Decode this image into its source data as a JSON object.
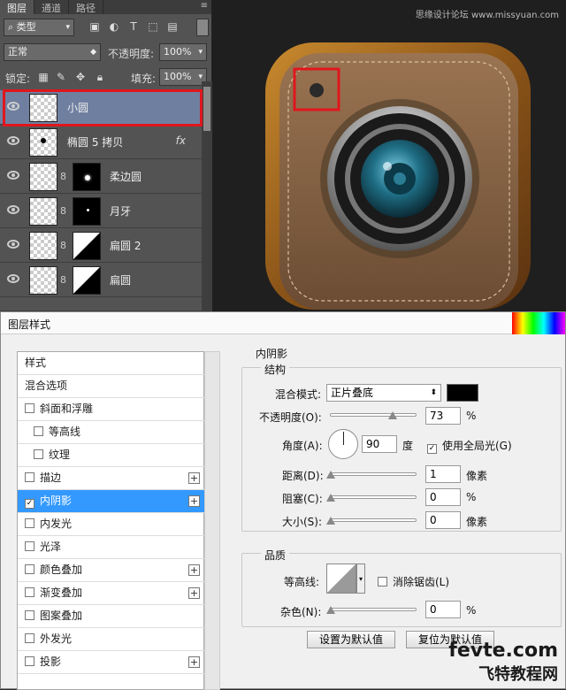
{
  "layers_panel": {
    "tabs": [
      "图层",
      "通道",
      "路径"
    ],
    "menu_icon": "≡",
    "filter_label": "类型",
    "blend_mode": "正常",
    "opacity_label": "不透明度:",
    "opacity_value": "100%",
    "lock_label": "锁定:",
    "fill_label": "填充:",
    "fill_value": "100%",
    "layers": [
      {
        "name": "小圆",
        "selected": true,
        "thumb": "small-dot"
      },
      {
        "name": "椭圆 5 拷贝",
        "fx": "fx",
        "thumb": "dot"
      },
      {
        "name": "柔边圆",
        "thumb": "mask-soft"
      },
      {
        "name": "月牙",
        "thumb": "mask-moon"
      },
      {
        "name": "扁圆 2",
        "thumb": "mask-tri"
      },
      {
        "name": "扁圆",
        "thumb": "mask-diag"
      }
    ]
  },
  "artwork": {
    "watermark": "思缘设计论坛 www.missyuan.com"
  },
  "dialog": {
    "title": "图层样式",
    "style_list": [
      {
        "label": "样式",
        "checkbox": false
      },
      {
        "label": "混合选项",
        "checkbox": false
      },
      {
        "label": "斜面和浮雕",
        "checkbox": true,
        "checked": false
      },
      {
        "label": "等高线",
        "checkbox": true,
        "checked": false,
        "indent": true
      },
      {
        "label": "纹理",
        "checkbox": true,
        "checked": false,
        "indent": true
      },
      {
        "label": "描边",
        "checkbox": true,
        "checked": false,
        "plus": true
      },
      {
        "label": "内阴影",
        "checkbox": true,
        "checked": true,
        "plus": true,
        "selected": true
      },
      {
        "label": "内发光",
        "checkbox": true,
        "checked": false
      },
      {
        "label": "光泽",
        "checkbox": true,
        "checked": false
      },
      {
        "label": "颜色叠加",
        "checkbox": true,
        "checked": false,
        "plus": true
      },
      {
        "label": "渐变叠加",
        "checkbox": true,
        "checked": false,
        "plus": true
      },
      {
        "label": "图案叠加",
        "checkbox": true,
        "checked": false
      },
      {
        "label": "外发光",
        "checkbox": true,
        "checked": false
      },
      {
        "label": "投影",
        "checkbox": true,
        "checked": false,
        "plus": true
      }
    ],
    "panel_title": "内阴影",
    "structure": {
      "title": "结构",
      "blend_label": "混合模式:",
      "blend_value": "正片叠底",
      "blend_color": "#000000",
      "opacity_label": "不透明度(O):",
      "opacity_value": "73",
      "opacity_unit": "%",
      "angle_label": "角度(A):",
      "angle_value": "90",
      "angle_unit": "度",
      "global_light_label": "使用全局光(G)",
      "global_light_checked": true,
      "distance_label": "距离(D):",
      "distance_value": "1",
      "distance_unit": "像素",
      "choke_label": "阻塞(C):",
      "choke_value": "0",
      "choke_unit": "%",
      "size_label": "大小(S):",
      "size_value": "0",
      "size_unit": "像素"
    },
    "quality": {
      "title": "品质",
      "contour_label": "等高线:",
      "antialias_label": "消除锯齿(L)",
      "antialias_checked": false,
      "noise_label": "杂色(N):",
      "noise_value": "0",
      "noise_unit": "%"
    },
    "buttons": {
      "set_default": "设置为默认值",
      "reset_default": "复位为默认值"
    },
    "watermark_line1": "fevte.com",
    "watermark_line2": "飞特教程网"
  }
}
